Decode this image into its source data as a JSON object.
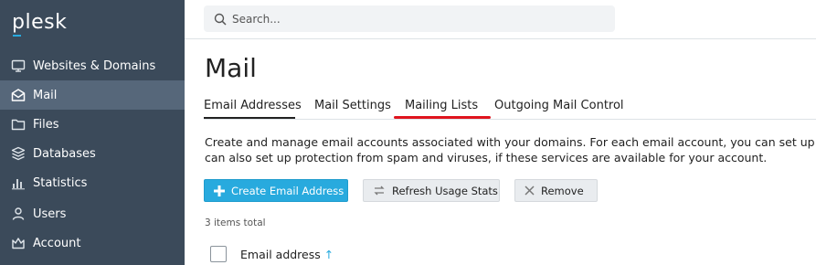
{
  "app": {
    "logo": "plesk"
  },
  "sidebar": {
    "items": [
      {
        "label": "Websites & Domains",
        "icon": "monitor-icon"
      },
      {
        "label": "Mail",
        "icon": "envelope-icon",
        "active": true
      },
      {
        "label": "Files",
        "icon": "folder-icon"
      },
      {
        "label": "Databases",
        "icon": "layers-icon"
      },
      {
        "label": "Statistics",
        "icon": "bar-chart-icon"
      },
      {
        "label": "Users",
        "icon": "user-icon"
      },
      {
        "label": "Account",
        "icon": "crown-icon"
      }
    ]
  },
  "header": {
    "search_placeholder": "Search..."
  },
  "main": {
    "title": "Mail",
    "tabs": [
      {
        "label": "Email Addresses",
        "active": true
      },
      {
        "label": "Mail Settings"
      },
      {
        "label": "Mailing Lists",
        "highlighted": true
      },
      {
        "label": "Outgoing Mail Control"
      }
    ],
    "description_line1": "Create and manage email accounts associated with your domains. For each email account, you can set up a mailbo",
    "description_line2": "can also set up protection from spam and viruses, if these services are available for your account.",
    "buttons": {
      "create": "Create Email Address",
      "refresh": "Refresh Usage Stats",
      "remove": "Remove"
    },
    "items_total": "3 items total",
    "table": {
      "columns": [
        {
          "label": "Email address",
          "sort": "ascending"
        }
      ]
    }
  },
  "colors": {
    "sidebar_bg": "#3b4a5a",
    "sidebar_active": "#56677a",
    "accent": "#28aade",
    "highlight": "#e0141e"
  }
}
